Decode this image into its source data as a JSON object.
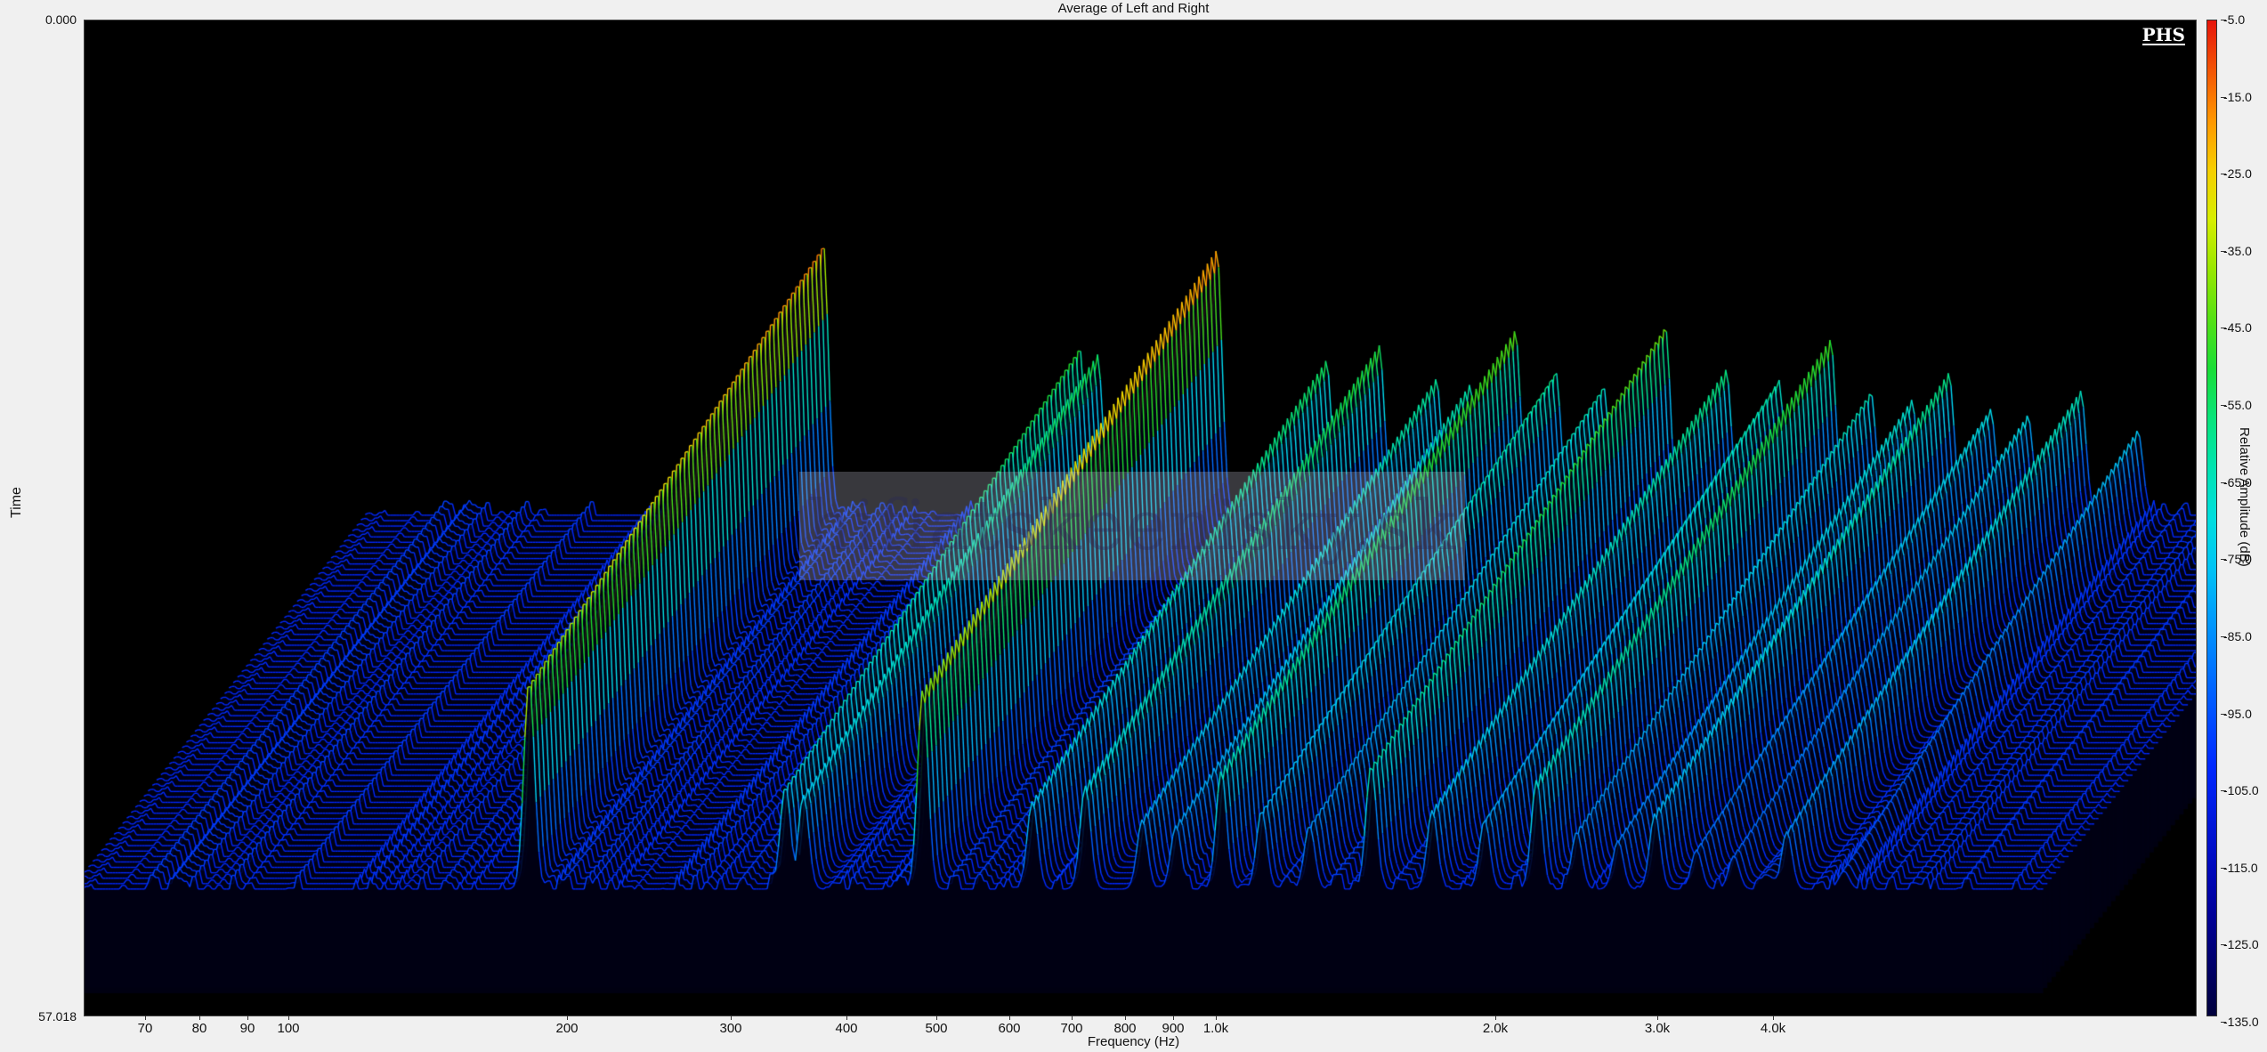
{
  "title": "Average of Left and Right",
  "y_axis": {
    "title": "Time",
    "top_label": "0.000",
    "bottom_label": "57.018"
  },
  "x_axis": {
    "title": "Frequency (Hz)",
    "ticks": [
      "70",
      "80",
      "90",
      "100",
      "200",
      "300",
      "400",
      "500",
      "600",
      "700",
      "800",
      "900",
      "1.0k",
      "2.0k",
      "3.0k",
      "4.0k"
    ]
  },
  "colorbar": {
    "title": "Relative Amplitude (dB)",
    "labels": [
      "-5.0",
      "-15.0",
      "-25.0",
      "-35.0",
      "-45.0",
      "-55.0",
      "-65.0",
      "-75.0",
      "-85.0",
      "-95.0",
      "-105.0",
      "-115.0",
      "-125.0",
      "-135.0"
    ]
  },
  "logo": "PHS",
  "watermark": "hifiatskeenisky.sk",
  "chart_data": {
    "type": "waterfall",
    "x_scale": "log",
    "xlabel": "Frequency (Hz)",
    "ylabel": "Time",
    "zlabel": "Relative Amplitude (dB)",
    "time_range": [
      0.0,
      57.018
    ],
    "z_range": [
      -135.0,
      -5.0
    ],
    "noise_floor_db": -103,
    "peaks": [
      {
        "freq_hz": 200,
        "amplitude_db": -12
      },
      {
        "freq_hz": 400,
        "amplitude_db": -47
      },
      {
        "freq_hz": 420,
        "amplitude_db": -50
      },
      {
        "freq_hz": 580,
        "amplitude_db": -15
      },
      {
        "freq_hz": 780,
        "amplitude_db": -52
      },
      {
        "freq_hz": 900,
        "amplitude_db": -47
      },
      {
        "freq_hz": 1050,
        "amplitude_db": -58
      },
      {
        "freq_hz": 1150,
        "amplitude_db": -60
      },
      {
        "freq_hz": 1300,
        "amplitude_db": -42
      },
      {
        "freq_hz": 1450,
        "amplitude_db": -55
      },
      {
        "freq_hz": 1650,
        "amplitude_db": -60
      },
      {
        "freq_hz": 1950,
        "amplitude_db": -40
      },
      {
        "freq_hz": 2300,
        "amplitude_db": -55
      },
      {
        "freq_hz": 2650,
        "amplitude_db": -58
      },
      {
        "freq_hz": 3050,
        "amplitude_db": -45
      },
      {
        "freq_hz": 3400,
        "amplitude_db": -62
      },
      {
        "freq_hz": 3800,
        "amplitude_db": -65
      },
      {
        "freq_hz": 4200,
        "amplitude_db": -56
      },
      {
        "freq_hz": 4700,
        "amplitude_db": -68
      },
      {
        "freq_hz": 5200,
        "amplitude_db": -70
      },
      {
        "freq_hz": 6000,
        "amplitude_db": -62
      },
      {
        "freq_hz": 7000,
        "amplitude_db": -75
      }
    ]
  }
}
